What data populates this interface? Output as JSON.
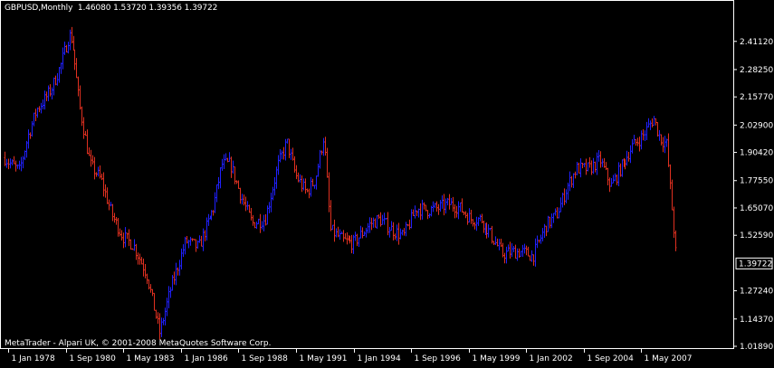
{
  "header": {
    "symbol_period": "GBPUSD,Monthly",
    "ohlc": "1.46080 1.53720 1.39356 1.39722"
  },
  "footer": {
    "copyright": "MetaTrader - Alpari UK, © 2001-2008 MetaQuotes Software Corp."
  },
  "price_scale_labels": [
    "2.41120",
    "2.28250",
    "2.15770",
    "2.02900",
    "1.90420",
    "1.77550",
    "1.65070",
    "1.52590",
    "1.27240",
    "1.14370",
    "1.01890"
  ],
  "current_price_label": "1.39722",
  "time_scale_labels": [
    "1 Jan 1978",
    "1 Sep 1980",
    "1 May 1983",
    "1 Jan 1986",
    "1 Sep 1988",
    "1 May 1991",
    "1 Jan 1994",
    "1 Sep 1996",
    "1 May 1999",
    "1 Jan 2002",
    "1 Sep 2004",
    "1 May 2007"
  ],
  "colors": {
    "background": "#000000",
    "axis": "#ffffff",
    "text": "#ffffff",
    "bull_bar": "#2020ff",
    "bear_bar": "#e03020"
  },
  "chart_data": {
    "type": "bar",
    "symbol": "GBPUSD",
    "timeframe": "Monthly",
    "ylim": [
      1.0189,
      2.4763
    ],
    "x_range": [
      "1977-11",
      "2008-09"
    ],
    "series": [
      {
        "values": [
          [
            1977.83,
            1.88
          ],
          [
            1978.0,
            1.86
          ],
          [
            1978.5,
            1.82
          ],
          [
            1978.9,
            1.98
          ],
          [
            1979.3,
            2.1
          ],
          [
            1979.7,
            2.15
          ],
          [
            1980.0,
            2.2
          ],
          [
            1980.4,
            2.3
          ],
          [
            1980.8,
            2.44
          ],
          [
            1980.95,
            2.42
          ],
          [
            1981.3,
            2.12
          ],
          [
            1981.8,
            1.85
          ],
          [
            1982.3,
            1.78
          ],
          [
            1982.8,
            1.62
          ],
          [
            1983.3,
            1.52
          ],
          [
            1983.8,
            1.48
          ],
          [
            1984.4,
            1.35
          ],
          [
            1985.0,
            1.08
          ],
          [
            1985.5,
            1.28
          ],
          [
            1986.2,
            1.5
          ],
          [
            1986.8,
            1.47
          ],
          [
            1987.5,
            1.65
          ],
          [
            1987.9,
            1.85
          ],
          [
            1988.3,
            1.85
          ],
          [
            1988.8,
            1.7
          ],
          [
            1989.3,
            1.58
          ],
          [
            1989.9,
            1.6
          ],
          [
            1990.5,
            1.85
          ],
          [
            1990.9,
            1.95
          ],
          [
            1991.3,
            1.8
          ],
          [
            1991.8,
            1.72
          ],
          [
            1992.2,
            1.78
          ],
          [
            1992.6,
            1.98
          ],
          [
            1992.9,
            1.55
          ],
          [
            1993.5,
            1.5
          ],
          [
            1994.0,
            1.49
          ],
          [
            1994.8,
            1.58
          ],
          [
            1995.2,
            1.6
          ],
          [
            1995.8,
            1.55
          ],
          [
            1996.3,
            1.52
          ],
          [
            1996.9,
            1.65
          ],
          [
            1997.4,
            1.64
          ],
          [
            1997.9,
            1.65
          ],
          [
            1998.4,
            1.67
          ],
          [
            1998.9,
            1.65
          ],
          [
            1999.4,
            1.6
          ],
          [
            1999.9,
            1.6
          ],
          [
            2000.4,
            1.52
          ],
          [
            2000.9,
            1.44
          ],
          [
            2001.3,
            1.45
          ],
          [
            2001.8,
            1.45
          ],
          [
            2002.3,
            1.43
          ],
          [
            2002.9,
            1.57
          ],
          [
            2003.4,
            1.62
          ],
          [
            2003.9,
            1.75
          ],
          [
            2004.3,
            1.83
          ],
          [
            2004.9,
            1.83
          ],
          [
            2005.4,
            1.87
          ],
          [
            2005.9,
            1.75
          ],
          [
            2006.4,
            1.84
          ],
          [
            2006.9,
            1.93
          ],
          [
            2007.4,
            1.98
          ],
          [
            2007.9,
            2.06
          ],
          [
            2008.2,
            1.97
          ],
          [
            2008.5,
            1.94
          ],
          [
            2008.7,
            1.7
          ],
          [
            2008.85,
            1.53
          ],
          [
            2008.95,
            1.4
          ]
        ]
      }
    ]
  }
}
